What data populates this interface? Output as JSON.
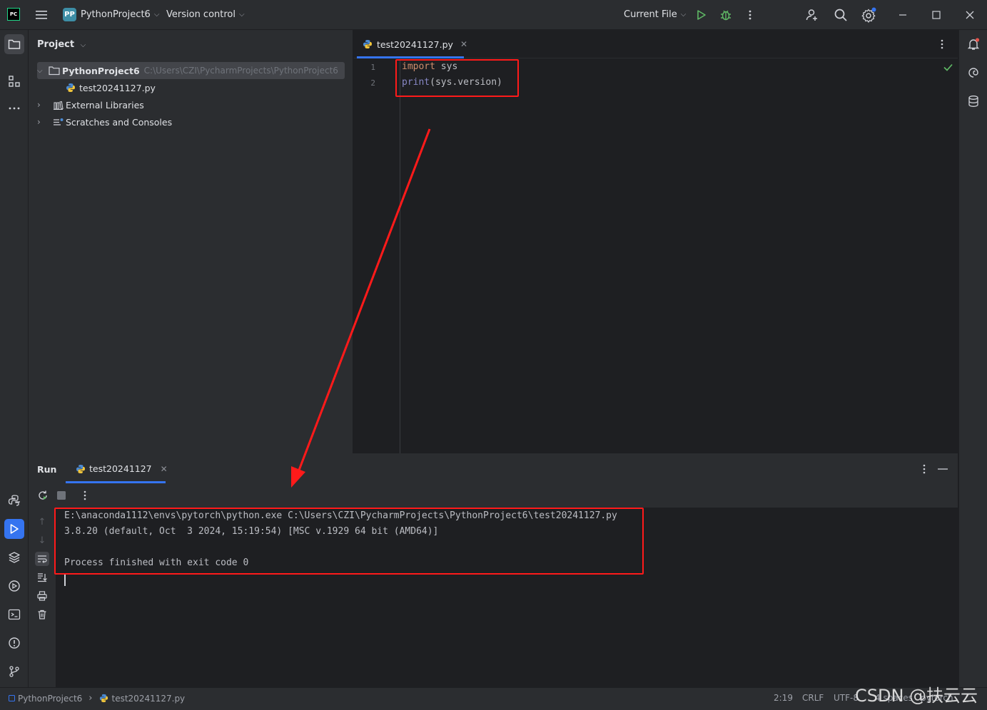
{
  "titlebar": {
    "logo": "PC",
    "project_badge": "PP",
    "project_name": "PythonProject6",
    "version_control": "Version control",
    "run_config": "Current File"
  },
  "project_panel": {
    "header": "Project",
    "root_name": "PythonProject6",
    "root_path": "C:\\Users\\CZI\\PycharmProjects\\PythonProject6",
    "file": "test20241127.py",
    "external_libraries": "External Libraries",
    "scratches": "Scratches and Consoles"
  },
  "editor": {
    "tab_label": "test20241127.py",
    "line_numbers": [
      "1",
      "2"
    ],
    "line1": {
      "kw": "import",
      "rest": " sys"
    },
    "line2": {
      "fn": "print",
      "rest": "(sys.version)"
    }
  },
  "run_panel": {
    "title": "Run",
    "tab_label": "test20241127",
    "output": [
      "E:\\anaconda1112\\envs\\pytorch\\python.exe C:\\Users\\CZI\\PycharmProjects\\PythonProject6\\test20241127.py",
      "3.8.20 (default, Oct  3 2024, 15:19:54) [MSC v.1929 64 bit (AMD64)]",
      "",
      "Process finished with exit code 0"
    ]
  },
  "statusbar": {
    "project": "PythonProject6",
    "file": "test20241127.py",
    "position": "2:19",
    "line_ending": "CRLF",
    "encoding": "UTF-8",
    "indent": "4 spaces",
    "interpreter": "pytorch"
  },
  "watermark": "CSDN @扶云云",
  "colors": {
    "accent": "#3574f0",
    "annotation_red": "#ff1a1a",
    "run_green": "#5fb865",
    "keyword": "#cf8e6d",
    "builtin": "#8888c6"
  }
}
